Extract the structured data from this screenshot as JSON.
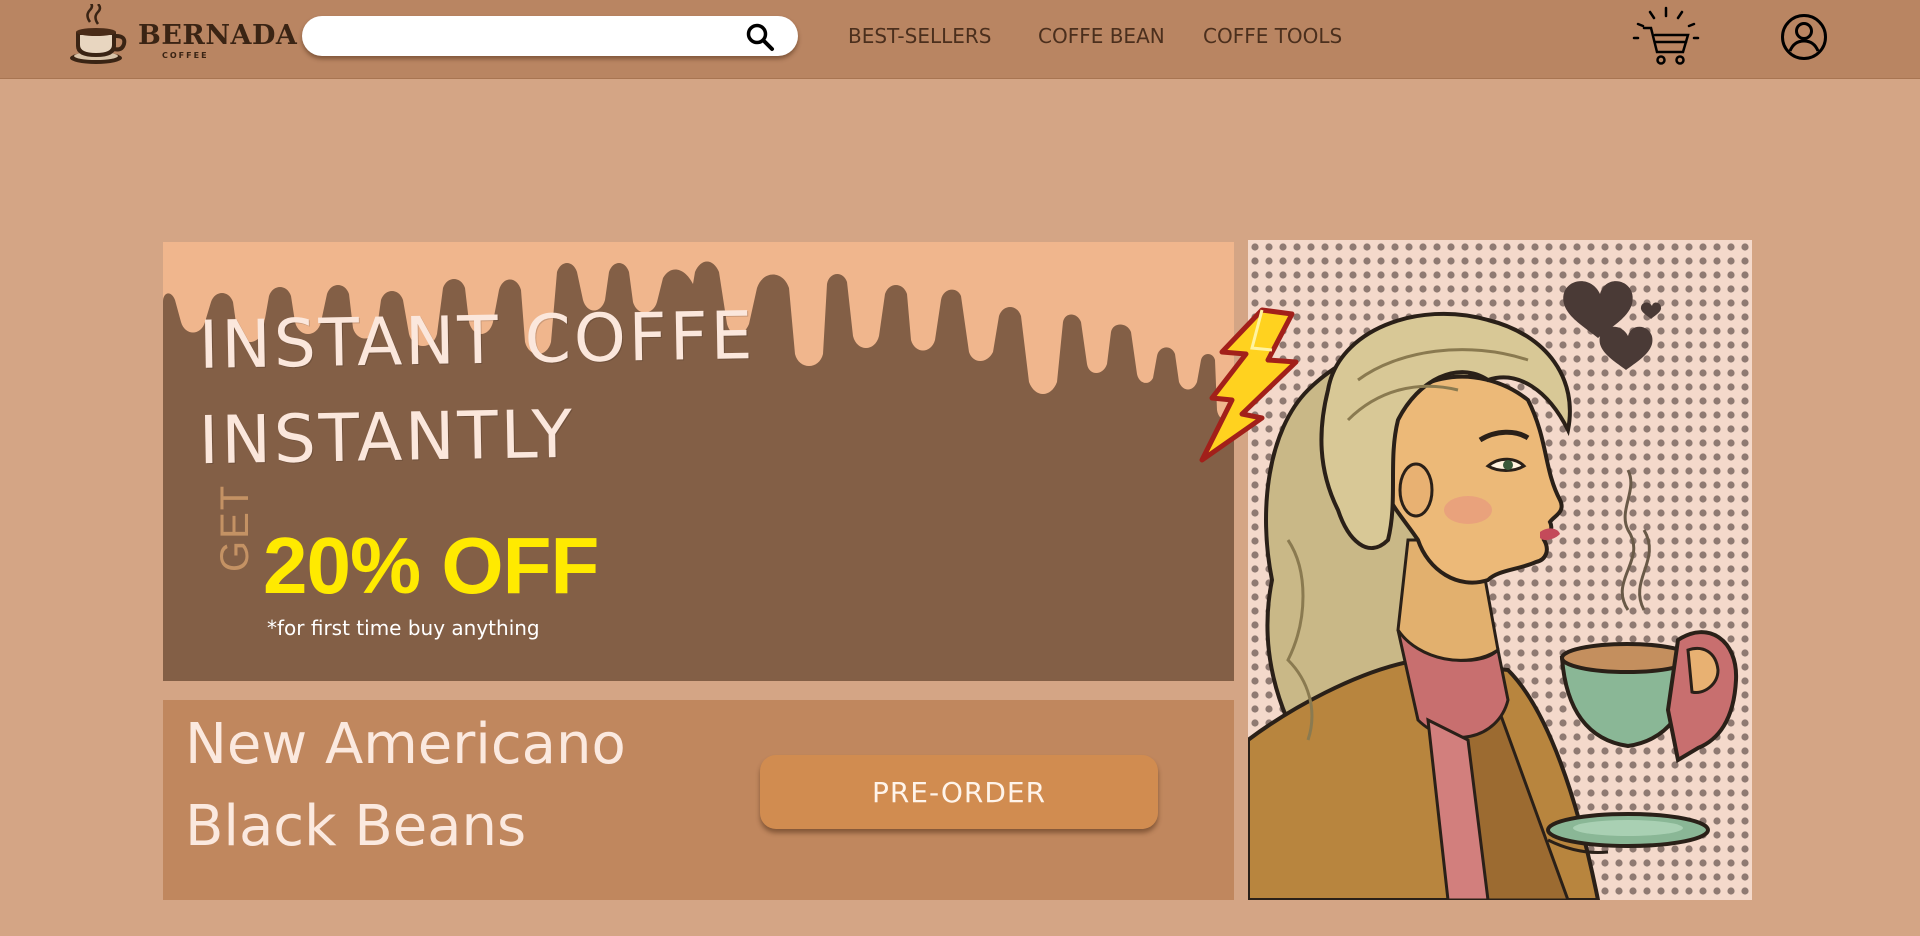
{
  "header": {
    "logo": {
      "name": "BERNADA",
      "sub": "COFFEE"
    },
    "search": {
      "placeholder": "",
      "value": ""
    },
    "nav": [
      "BEST-SELLERS",
      "COFFE BEAN",
      "COFFE TOOLS"
    ]
  },
  "promo": {
    "title_line1": "INSTANT COFFE",
    "title_line2": "INSTANTLY",
    "get_label": "GET",
    "discount": "20% OFF",
    "fineprint": "*for first time buy anything"
  },
  "product": {
    "name_line1": "New Americano",
    "name_line2": "Black Beans",
    "cta_label": "PRE-ORDER"
  },
  "icons": {
    "search": "search-icon",
    "cart": "shopping-cart-icon",
    "account": "user-account-icon",
    "lightning": "lightning-bolt-icon",
    "hearts": "heart-icon"
  },
  "colors": {
    "page_bg": "#d4a585",
    "header_bg": "#b98562",
    "promo_bg": "#835f46",
    "drip": "#f0b68d",
    "discount": "#ffea00",
    "product_bg": "#c0875e",
    "cta_bg": "#d18c50"
  }
}
